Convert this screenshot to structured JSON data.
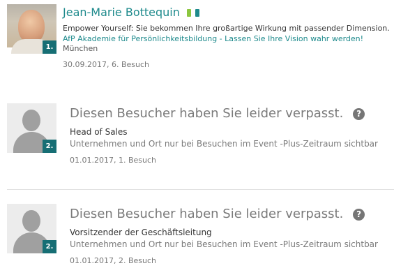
{
  "visitors": [
    {
      "rank": "1.",
      "name": "Jean-Marie Bottequin",
      "tag_colors": [
        "#8cc63f",
        "#1e8a8c"
      ],
      "headline": "Empower Yourself: Sie bekommen Ihre großartige Wirkung mit passender Dimension.",
      "company": "AfP Akademie für Persönlichkeitsbildung - Lassen Sie Ihre Vision wahr werden!",
      "city": "München",
      "date_visit": "30.09.2017, 6. Besuch"
    },
    {
      "rank": "2.",
      "missed_title": "Diesen Besucher haben Sie leider verpasst.",
      "help_icon": "?",
      "job_title": "Head of Sales",
      "hidden_info": "Unternehmen und Ort nur bei Besuchen im Event -Plus-Zeitraum sichtbar",
      "date_visit": "01.01.2017, 1. Besuch"
    },
    {
      "rank": "2.",
      "missed_title": "Diesen Besucher haben Sie leider verpasst.",
      "help_icon": "?",
      "job_title": "Vorsitzender der Geschäftsleitung",
      "hidden_info": "Unternehmen und Ort nur bei Besuchen im Event -Plus-Zeitraum sichtbar",
      "date_visit": "01.01.2017, 2. Besuch"
    }
  ]
}
